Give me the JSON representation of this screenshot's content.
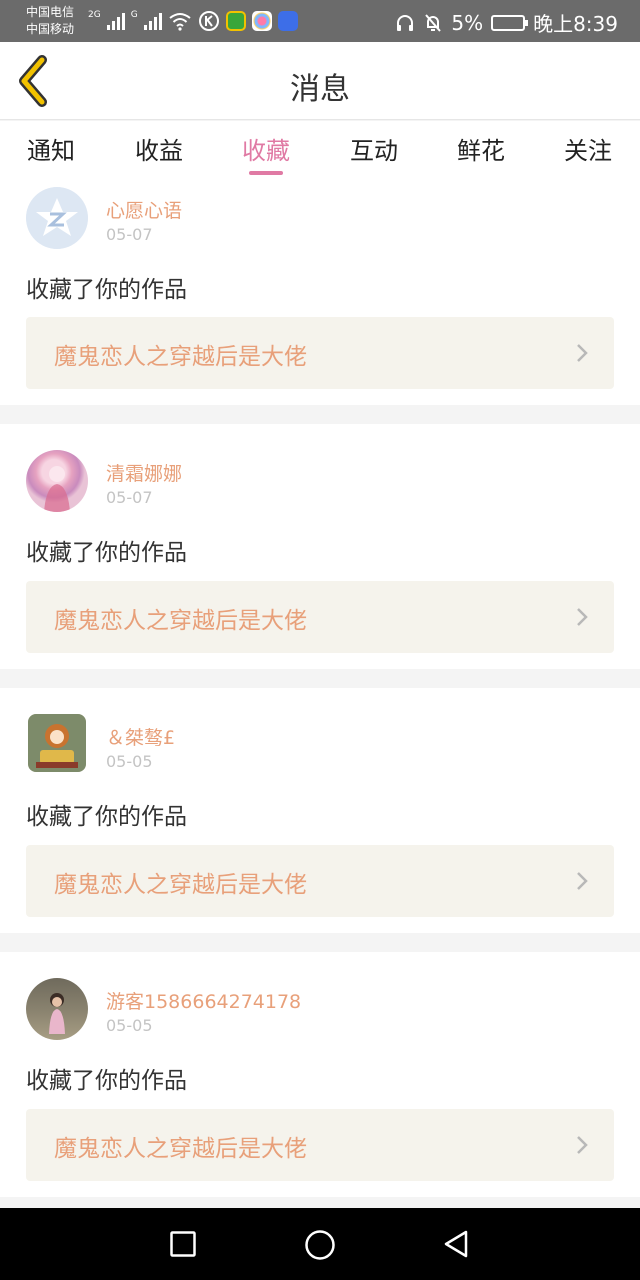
{
  "status_bar": {
    "carrier_1": "中国电信",
    "carrier_2": "中国移动",
    "net_1": "2G",
    "net_2": "G",
    "battery": "5%",
    "time": "晚上8:39",
    "icons": [
      "signal-icon",
      "wifi-icon",
      "k-app-icon",
      "green-app-icon",
      "photos-app-icon",
      "music-app-icon",
      "headphones-icon",
      "mute-bell-icon",
      "battery-icon"
    ]
  },
  "header": {
    "title": "消息",
    "back_icon": "chevron-left-icon"
  },
  "tabs": [
    {
      "label": "通知"
    },
    {
      "label": "收益"
    },
    {
      "label": "收藏"
    },
    {
      "label": "互动"
    },
    {
      "label": "鲜花"
    },
    {
      "label": "关注"
    }
  ],
  "active_tab": "收藏",
  "messages": [
    {
      "user": "心愿心语",
      "date": "05-07",
      "text": "收藏了你的作品",
      "work": "魔鬼恋人之穿越后是大佬",
      "avatar": "default-avatar-icon"
    },
    {
      "user": "清霜娜娜",
      "date": "05-07",
      "text": "收藏了你的作品",
      "work": "魔鬼恋人之穿越后是大佬",
      "avatar": "anime-girl-avatar"
    },
    {
      "user": "＆桀骜£",
      "date": "05-05",
      "text": "收藏了你的作品",
      "work": "魔鬼恋人之穿越后是大佬",
      "avatar": "cartoon-girl-avatar"
    },
    {
      "user": "游客1586664274178",
      "date": "05-05",
      "text": "收藏了你的作品",
      "work": "魔鬼恋人之穿越后是大佬",
      "avatar": "child-photo-avatar"
    }
  ],
  "nav_bar": {
    "buttons": [
      "recents-square-icon",
      "home-circle-icon",
      "back-triangle-icon"
    ]
  },
  "colors": {
    "accent_pink": "#e07aa4",
    "accent_orange": "#e8a07a",
    "link_bg": "#f5f3ec"
  }
}
